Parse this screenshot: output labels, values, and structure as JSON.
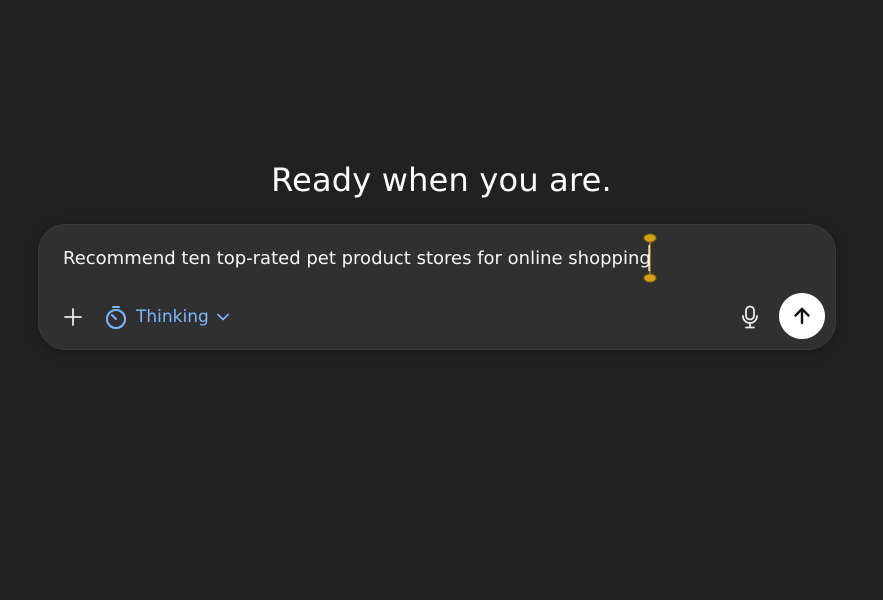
{
  "heading": "Ready when you are.",
  "composer": {
    "input_value": "Recommend ten top-rated pet product stores for online shopping",
    "mode_label": "Thinking",
    "icons": {
      "add": "plus-icon",
      "mode": "timer-icon",
      "mode_dropdown": "chevron-down-icon",
      "mic": "microphone-icon",
      "send": "arrow-up-icon"
    }
  },
  "colors": {
    "background": "#212121",
    "composer_background": "#303030",
    "accent": "#7ab7ff",
    "cursor_accent": "#d4a017",
    "send_button": "#ffffff"
  }
}
